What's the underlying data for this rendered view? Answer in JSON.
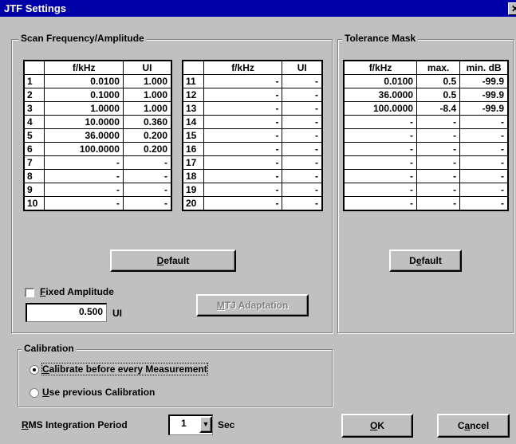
{
  "window": {
    "title": "JTF Settings",
    "close_glyph": "✕"
  },
  "scan": {
    "legend": "Scan Frequency/Amplitude",
    "headers": [
      "",
      "f/kHz",
      "UI"
    ],
    "left_rows": [
      [
        "1",
        "0.0100",
        "1.000"
      ],
      [
        "2",
        "0.1000",
        "1.000"
      ],
      [
        "3",
        "1.0000",
        "1.000"
      ],
      [
        "4",
        "10.0000",
        "0.360"
      ],
      [
        "5",
        "36.0000",
        "0.200"
      ],
      [
        "6",
        "100.0000",
        "0.200"
      ],
      [
        "7",
        "-",
        "-"
      ],
      [
        "8",
        "-",
        "-"
      ],
      [
        "9",
        "-",
        "-"
      ],
      [
        "10",
        "-",
        "-"
      ]
    ],
    "right_rows": [
      [
        "11",
        "-",
        "-"
      ],
      [
        "12",
        "-",
        "-"
      ],
      [
        "13",
        "-",
        "-"
      ],
      [
        "14",
        "-",
        "-"
      ],
      [
        "15",
        "-",
        "-"
      ],
      [
        "16",
        "-",
        "-"
      ],
      [
        "17",
        "-",
        "-"
      ],
      [
        "18",
        "-",
        "-"
      ],
      [
        "19",
        "-",
        "-"
      ],
      [
        "20",
        "-",
        "-"
      ]
    ],
    "default_button": {
      "underlined": "D",
      "rest": "efault"
    },
    "fixed_amplitude": {
      "checked": false,
      "underlined": "F",
      "rest": "ixed Amplitude"
    },
    "amplitude_value": "0.500",
    "amplitude_unit": "UI",
    "mtj_button": {
      "underlined": "M",
      "rest": "TJ Adaptation",
      "disabled": true
    }
  },
  "tolerance": {
    "legend": "Tolerance Mask",
    "headers": [
      "f/kHz",
      "max.",
      "min. dB"
    ],
    "rows": [
      [
        "0.0100",
        "0.5",
        "-99.9"
      ],
      [
        "36.0000",
        "0.5",
        "-99.9"
      ],
      [
        "100.0000",
        "-8.4",
        "-99.9"
      ],
      [
        "-",
        "-",
        "-"
      ],
      [
        "-",
        "-",
        "-"
      ],
      [
        "-",
        "-",
        "-"
      ],
      [
        "-",
        "-",
        "-"
      ],
      [
        "-",
        "-",
        "-"
      ],
      [
        "-",
        "-",
        "-"
      ],
      [
        "-",
        "-",
        "-"
      ]
    ],
    "default_button": {
      "pre": "D",
      "underlined": "e",
      "rest": "fault"
    }
  },
  "calibration": {
    "legend": "Calibration",
    "options": [
      {
        "underlined": "C",
        "rest": "alibrate before every Measurement",
        "selected": true
      },
      {
        "underlined": "U",
        "rest": "se previous Calibration",
        "selected": false
      }
    ]
  },
  "rms": {
    "underlined": "R",
    "rest": "MS Integration Period",
    "value": "1",
    "unit": "Sec"
  },
  "buttons": {
    "ok": {
      "underlined": "O",
      "rest": "K"
    },
    "cancel": {
      "pre": "C",
      "underlined": "a",
      "rest": "ncel"
    }
  }
}
